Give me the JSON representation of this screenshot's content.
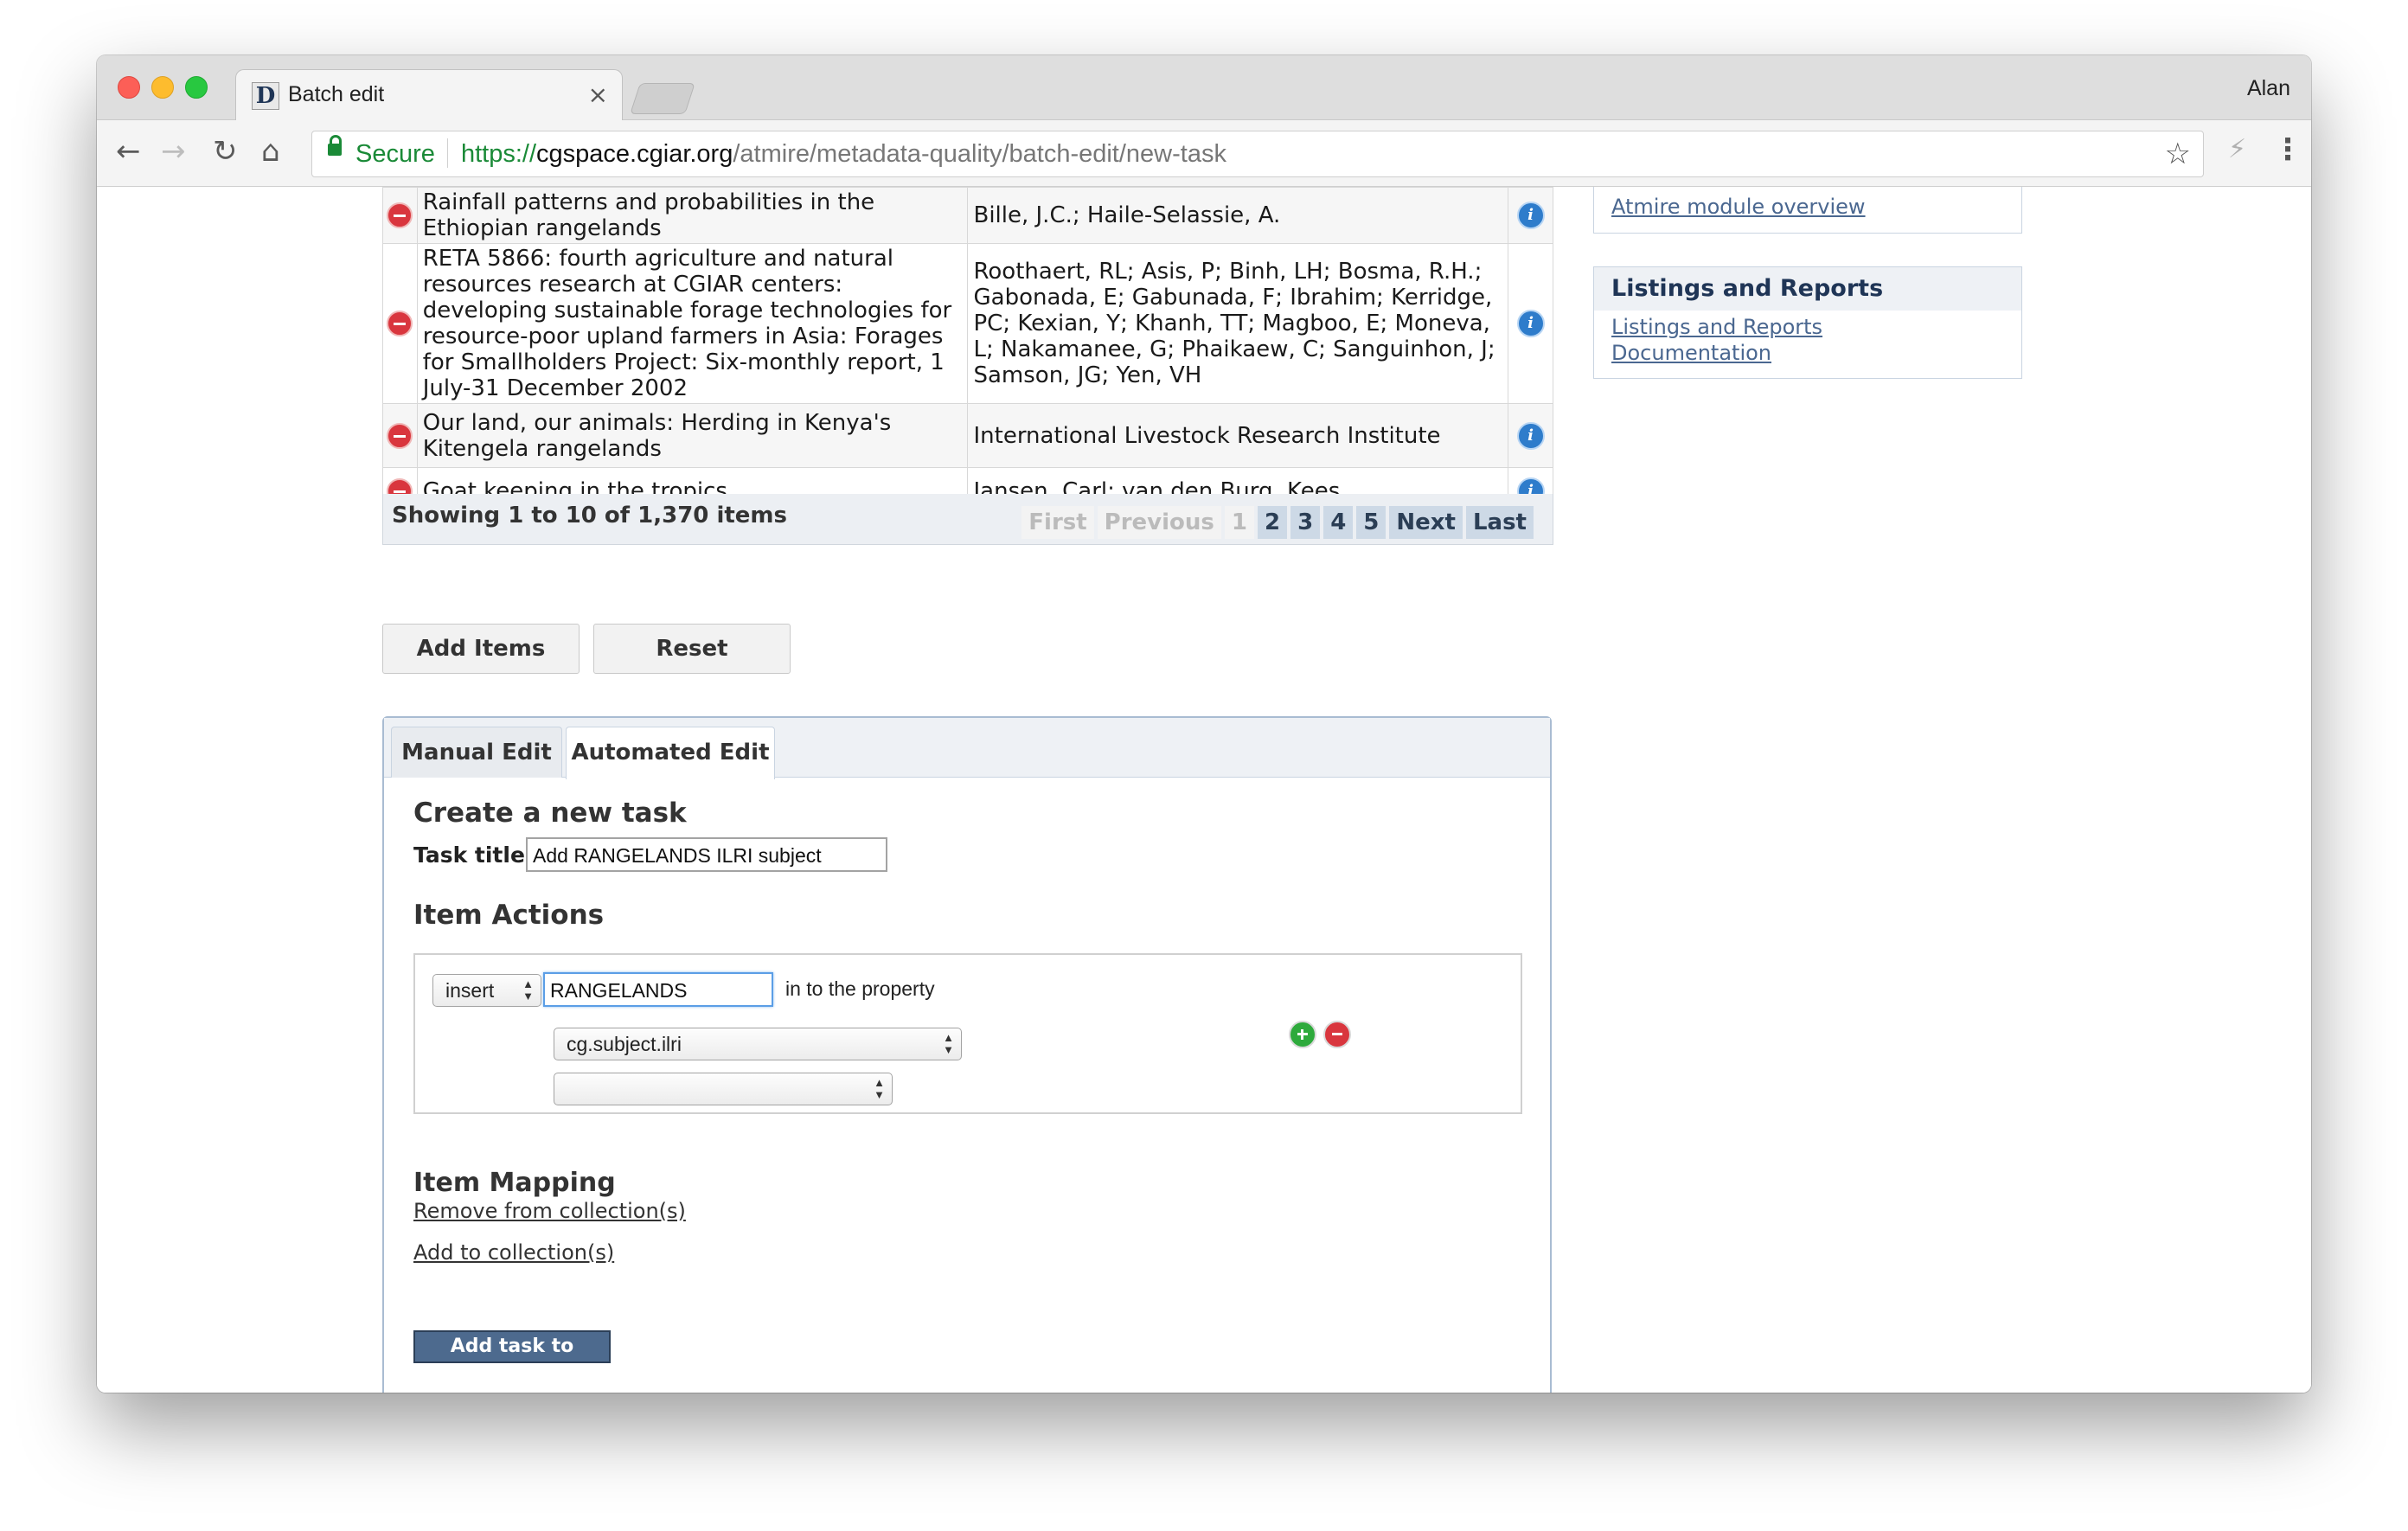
{
  "browser": {
    "tab_title": "Batch edit",
    "tab_close": "×",
    "favicon_letter": "D",
    "user": "Alan",
    "secure_label": "Secure",
    "url_scheme": "https://",
    "url_host": "cgspace.cgiar.org",
    "url_path": "/atmire/metadata-quality/batch-edit/new-task",
    "icons": {
      "back": "←",
      "forward": "→",
      "reload": "↻",
      "home": "⌂",
      "star": "☆",
      "extension": "⚡",
      "menu": "⋮"
    }
  },
  "items_table": {
    "rows": [
      {
        "title": "Rainfall patterns and probabilities in the Ethiopian rangelands",
        "authors": "Bille, J.C.; Haile-Selassie, A."
      },
      {
        "title": "RETA 5866: fourth agriculture and natural resources research at CGIAR centers: developing sustainable forage technologies for resource-poor upland farmers in Asia: Forages for Smallholders Project: Six-monthly report, 1 July-31 December 2002",
        "authors": "Roothaert, RL; Asis, P; Binh, LH; Bosma, R.H.; Gabonada, E; Gabunada, F; Ibrahim; Kerridge, PC; Kexian, Y; Khanh, TT; Magboo, E; Moneva, L; Nakamanee, G; Phaikaew, C; Sanguinhon, J; Samson, JG; Yen, VH"
      },
      {
        "title": "Our land, our animals: Herding in Kenya's Kitengela rangelands",
        "authors": "International Livestock Research Institute"
      },
      {
        "title": "Goat keeping in the tropics",
        "authors": "Jansen, Carl; van den Burg, Kees"
      }
    ],
    "info_glyph": "i",
    "showing": "Showing 1 to 10 of 1,370 items",
    "pager": [
      "First",
      "Previous",
      "1",
      "2",
      "3",
      "4",
      "5",
      "Next",
      "Last"
    ]
  },
  "buttons": {
    "add_items": "Add Items",
    "reset": "Reset"
  },
  "edit_panel": {
    "tabs": [
      "Manual Edit",
      "Automated Edit"
    ],
    "create_heading": "Create a new task",
    "task_title_label": "Task title:",
    "task_title_value": "Add RANGELANDS ILRI subject",
    "item_actions_heading": "Item Actions",
    "action_select": "insert",
    "action_value": "RANGELANDS",
    "action_text": "in to the property",
    "property_select": "cg.subject.ilri",
    "second_select": "",
    "item_mapping_heading": "Item Mapping",
    "remove_link": "Remove from collection(s)",
    "add_link": "Add to collection(s)",
    "queue_button": "Add task to queue"
  },
  "sidebar": {
    "atmire_link": "Atmire module overview",
    "listings_heading": "Listings and Reports",
    "listings_link": "Listings and Reports Documentation"
  }
}
